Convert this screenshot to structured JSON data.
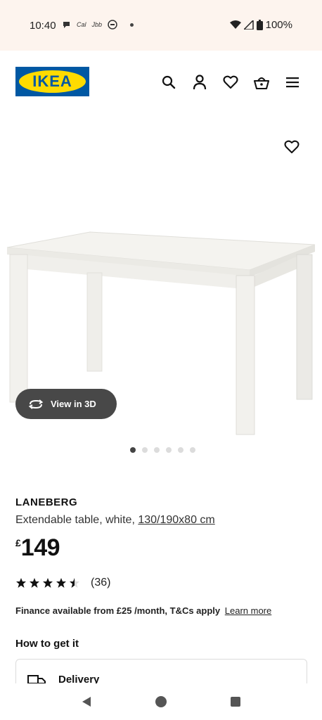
{
  "status_bar": {
    "time": "10:40",
    "battery": "100%"
  },
  "header": {
    "logo_text": "IKEA",
    "icons": [
      "search-icon",
      "account-icon",
      "heart-icon",
      "basket-icon",
      "menu-icon"
    ]
  },
  "gallery": {
    "view3d_label": "View in 3D",
    "dots_total": 6,
    "dots_active": 1
  },
  "product": {
    "name": "LANEBERG",
    "description": "Extendable table, white,",
    "size_link": "130/190x80 cm",
    "currency": "£",
    "price": "149",
    "rating_value": 4.5,
    "rating_count": "(36)"
  },
  "finance": {
    "text": "Finance available from £25 /month, T&Cs apply",
    "link": "Learn more"
  },
  "delivery": {
    "heading": "How to get it",
    "delivery_label": "Delivery"
  },
  "colors": {
    "brand_blue": "#0058a3",
    "brand_yellow": "#ffdb00",
    "button_dark": "#484848",
    "status_bg": "#fdf4ee"
  }
}
